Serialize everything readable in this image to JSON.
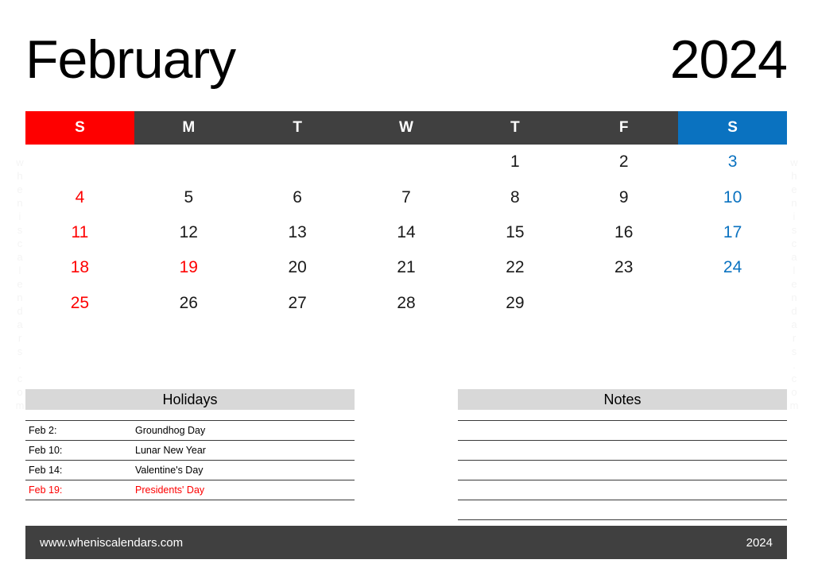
{
  "header": {
    "month": "February",
    "year": "2024"
  },
  "weekdays": [
    {
      "label": "S",
      "kind": "sun"
    },
    {
      "label": "M",
      "kind": "weekday"
    },
    {
      "label": "T",
      "kind": "weekday"
    },
    {
      "label": "W",
      "kind": "weekday"
    },
    {
      "label": "T",
      "kind": "weekday"
    },
    {
      "label": "F",
      "kind": "weekday"
    },
    {
      "label": "S",
      "kind": "sat"
    }
  ],
  "weeks": [
    [
      {
        "day": "",
        "color": "empty"
      },
      {
        "day": "",
        "color": "empty"
      },
      {
        "day": "",
        "color": "empty"
      },
      {
        "day": "",
        "color": "empty"
      },
      {
        "day": "1",
        "color": "black"
      },
      {
        "day": "2",
        "color": "black"
      },
      {
        "day": "3",
        "color": "blue"
      }
    ],
    [
      {
        "day": "4",
        "color": "red"
      },
      {
        "day": "5",
        "color": "black"
      },
      {
        "day": "6",
        "color": "black"
      },
      {
        "day": "7",
        "color": "black"
      },
      {
        "day": "8",
        "color": "black"
      },
      {
        "day": "9",
        "color": "black"
      },
      {
        "day": "10",
        "color": "blue"
      }
    ],
    [
      {
        "day": "11",
        "color": "red"
      },
      {
        "day": "12",
        "color": "black"
      },
      {
        "day": "13",
        "color": "black"
      },
      {
        "day": "14",
        "color": "black"
      },
      {
        "day": "15",
        "color": "black"
      },
      {
        "day": "16",
        "color": "black"
      },
      {
        "day": "17",
        "color": "blue"
      }
    ],
    [
      {
        "day": "18",
        "color": "red"
      },
      {
        "day": "19",
        "color": "red"
      },
      {
        "day": "20",
        "color": "black"
      },
      {
        "day": "21",
        "color": "black"
      },
      {
        "day": "22",
        "color": "black"
      },
      {
        "day": "23",
        "color": "black"
      },
      {
        "day": "24",
        "color": "blue"
      }
    ],
    [
      {
        "day": "25",
        "color": "red"
      },
      {
        "day": "26",
        "color": "black"
      },
      {
        "day": "27",
        "color": "black"
      },
      {
        "day": "28",
        "color": "black"
      },
      {
        "day": "29",
        "color": "black"
      },
      {
        "day": "",
        "color": "empty"
      },
      {
        "day": "",
        "color": "empty"
      }
    ]
  ],
  "holidays": {
    "title": "Holidays",
    "items": [
      {
        "date": "Feb 2:",
        "name": "Groundhog Day",
        "highlight": false
      },
      {
        "date": "Feb 10:",
        "name": "Lunar New Year",
        "highlight": false
      },
      {
        "date": "Feb 14:",
        "name": "Valentine's Day",
        "highlight": false
      },
      {
        "date": "Feb 19:",
        "name": "Presidents' Day",
        "highlight": true
      }
    ]
  },
  "notes": {
    "title": "Notes",
    "line_count": 5
  },
  "watermark": {
    "text": "wheniscalendars.com"
  },
  "footer": {
    "site": "www.wheniscalendars.com",
    "year": "2024"
  },
  "colors": {
    "sunday_red": "#fe0000",
    "saturday_blue": "#0a72c0",
    "header_dark": "#404040",
    "panel_gray": "#d8d8d8"
  }
}
